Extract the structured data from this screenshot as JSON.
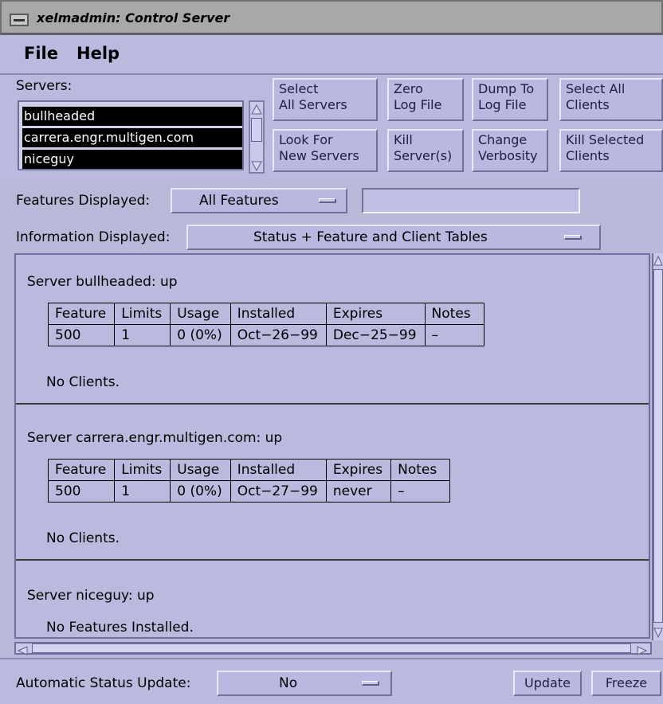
{
  "window": {
    "title": "xelmadmin: Control Server"
  },
  "menubar": {
    "file": "File",
    "help": "Help"
  },
  "servers": {
    "label": "Servers:",
    "items": [
      "bullheaded",
      "carrera.engr.multigen.com",
      "niceguy"
    ]
  },
  "buttons": {
    "select_all_servers": [
      "Select",
      "All Servers"
    ],
    "look_for_new_servers": [
      "Look For",
      "New Servers"
    ],
    "zero_log_file": [
      "Zero",
      "Log File"
    ],
    "kill_servers": [
      "Kill",
      "Server(s)"
    ],
    "dump_to_log_file": [
      "Dump To",
      "Log File"
    ],
    "change_verbosity": [
      "Change",
      "Verbosity"
    ],
    "select_all_clients": [
      "Select All",
      "Clients"
    ],
    "kill_selected_clients": [
      "Kill Selected",
      "Clients"
    ]
  },
  "features": {
    "label": "Features Displayed:",
    "value": "All Features",
    "filter_value": ""
  },
  "information": {
    "label": "Information Displayed:",
    "value": "Status + Feature and Client Tables"
  },
  "table_headers": [
    "Feature",
    "Limits",
    "Usage",
    "Installed",
    "Expires",
    "Notes"
  ],
  "server_reports": [
    {
      "title": "Server bullheaded:  up",
      "rows": [
        [
          "500",
          "1",
          "0  (0%)",
          "Oct−26−99",
          "Dec−25−99",
          "–"
        ]
      ],
      "clients": "No Clients."
    },
    {
      "title": "Server carrera.engr.multigen.com:  up",
      "rows": [
        [
          "500",
          "1",
          "0  (0%)",
          "Oct−27−99",
          "never",
          "–"
        ]
      ],
      "clients": "No Clients."
    },
    {
      "title": "Server niceguy:  up",
      "no_features": "No Features Installed."
    }
  ],
  "bottom": {
    "auto_update_label": "Automatic Status Update:",
    "auto_update_value": "No",
    "update": "Update",
    "freeze": "Freeze"
  }
}
